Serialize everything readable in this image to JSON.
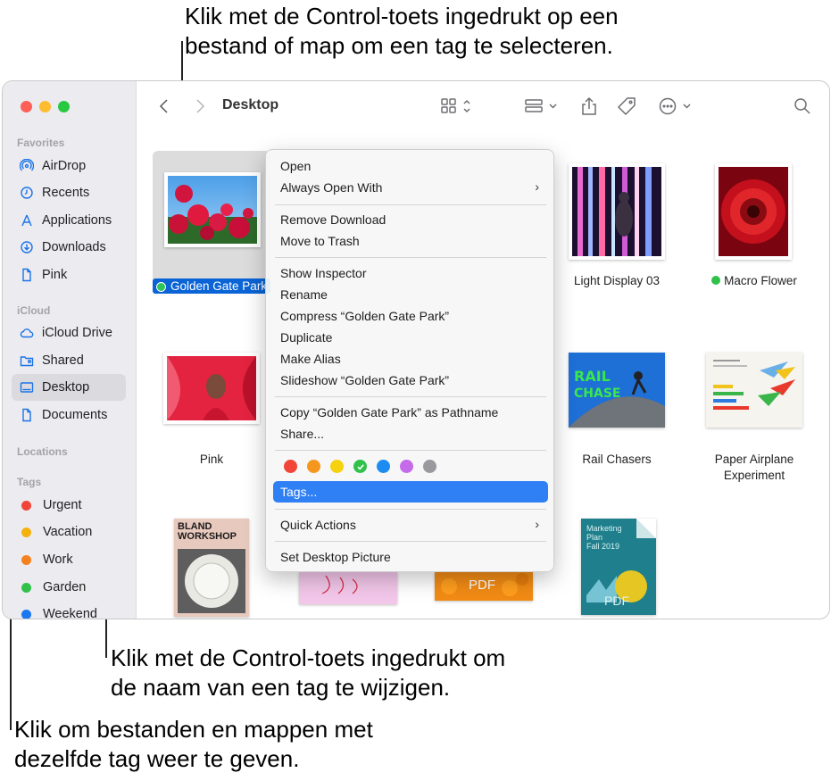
{
  "callouts": {
    "top": [
      "Klik met de Control-toets ingedrukt op een",
      "bestand of map om een tag te selecteren."
    ],
    "middle": [
      "Klik met de Control-toets ingedrukt om",
      "de naam van een tag te wijzigen."
    ],
    "bottom": [
      "Klik om bestanden en mappen met",
      "dezelfde tag weer te geven."
    ]
  },
  "toolbar": {
    "title": "Desktop"
  },
  "sidebar": {
    "favorites_label": "Favorites",
    "favorites": [
      "AirDrop",
      "Recents",
      "Applications",
      "Downloads",
      "Pink"
    ],
    "icloud_label": "iCloud",
    "icloud": [
      "iCloud Drive",
      "Shared",
      "Desktop",
      "Documents"
    ],
    "locations_label": "Locations",
    "tags_label": "Tags",
    "tags": [
      {
        "label": "Urgent",
        "color": "#f04538"
      },
      {
        "label": "Vacation",
        "color": "#f5b20f"
      },
      {
        "label": "Work",
        "color": "#f5801f"
      },
      {
        "label": "Garden",
        "color": "#30c14b"
      },
      {
        "label": "Weekend",
        "color": "#1c78f0"
      }
    ]
  },
  "files": {
    "golden_gate": "Golden Gate Park",
    "light_display": "Light Display 03",
    "macro_flower": "Macro Flower",
    "pink": "Pink",
    "rail_chasers": "Rail Chasers",
    "paper_airplane_1": "Paper Airplane",
    "paper_airplane_2": "Experiment",
    "bland_1": "BLAND",
    "bland_2": "WORKSHOP",
    "marketing_1": "Marketing",
    "marketing_2": "Plan",
    "marketing_3": "Fall 2019",
    "pdf": "PDF"
  },
  "context_menu": {
    "items": [
      "Open",
      "Always Open With",
      "Remove Download",
      "Move to Trash",
      "Show Inspector",
      "Rename",
      "Compress “Golden Gate Park”",
      "Duplicate",
      "Make Alias",
      "Slideshow “Golden Gate Park”",
      "Copy “Golden Gate Park” as Pathname",
      "Share...",
      "Tags...",
      "Quick Actions",
      "Set Desktop Picture"
    ],
    "tag_colors": [
      "#f04538",
      "#f5961f",
      "#f5d10f",
      "#30c14b",
      "#1c8cf0",
      "#c56bea",
      "#9a9a9e"
    ]
  }
}
